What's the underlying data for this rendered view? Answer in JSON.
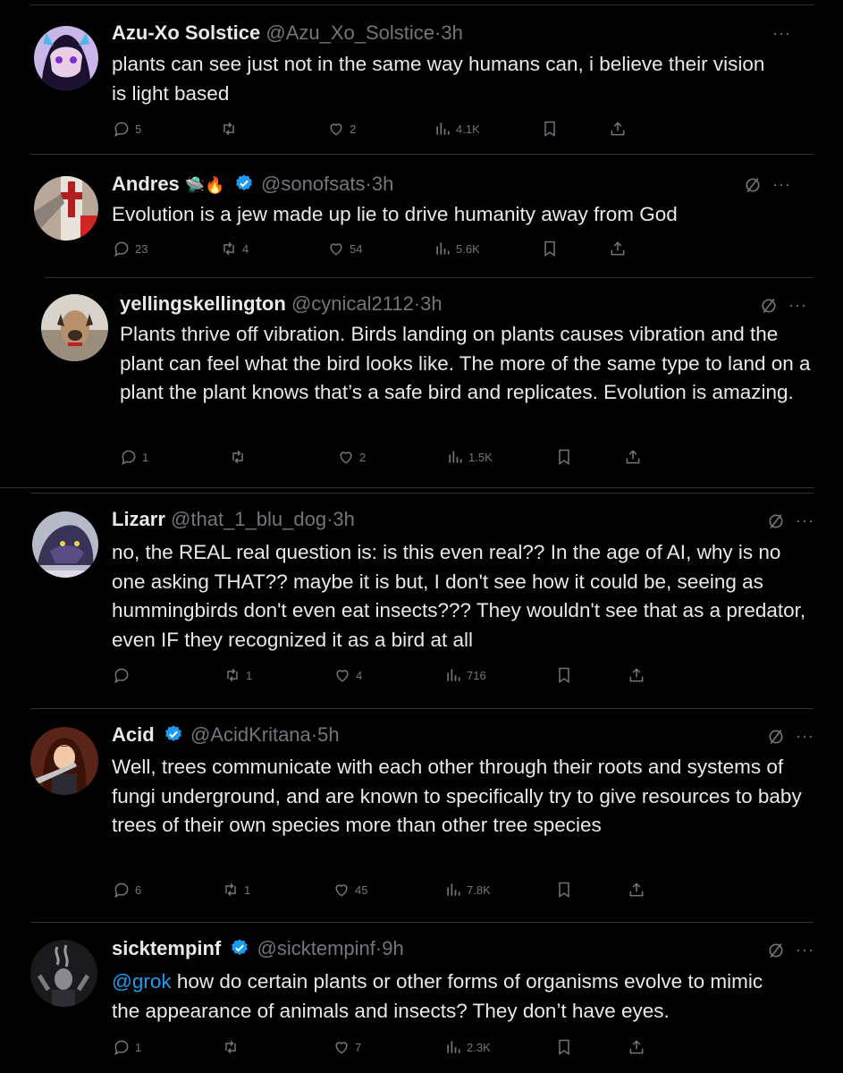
{
  "tweets": [
    {
      "name": "Azu-Xo Solstice",
      "emoji": "",
      "verified": false,
      "handle": "@Azu_Xo_Solstice",
      "time": "3h",
      "text": "plants can see just not in the same way humans can, i believe their vision is light based",
      "replies": "5",
      "retweets": "",
      "likes": "2",
      "views": "4.1K",
      "grok": false
    },
    {
      "name": "Andres",
      "emoji": "🛸🔥",
      "verified": true,
      "handle": "@sonofsats",
      "time": "3h",
      "text": "Evolution is a jew made up lie to drive humanity away from God",
      "replies": "23",
      "retweets": "4",
      "likes": "54",
      "views": "5.6K",
      "grok": true
    },
    {
      "name": "yellingskellington",
      "emoji": "",
      "verified": false,
      "handle": "@cynical2112",
      "time": "3h",
      "text": "Plants thrive off vibration. Birds landing on plants causes vibration and the plant can feel what the bird looks like. The more of the same type to land on a plant the plant knows that’s a safe bird and replicates. Evolution is amazing.",
      "replies": "1",
      "retweets": "",
      "likes": "2",
      "views": "1.5K",
      "grok": true
    },
    {
      "name": "Lizarr",
      "emoji": "",
      "verified": false,
      "handle": "@that_1_blu_dog",
      "time": "3h",
      "text": "no, the REAL real question is: is this even real?? In the age of AI, why is no one asking THAT?? maybe it is but, I don't see how it could be, seeing as hummingbirds don't even eat insects??? They wouldn't see that as a predator, even IF they recognized it as a bird at all",
      "replies": "",
      "retweets": "1",
      "likes": "4",
      "views": "716",
      "grok": true
    },
    {
      "name": "Acid",
      "emoji": "",
      "verified": true,
      "handle": "@AcidKritana",
      "time": "5h",
      "text": "Well, trees communicate with each other through their roots and systems of fungi underground, and are known to specifically try to give resources to baby trees of their own species more than other tree species",
      "replies": "6",
      "retweets": "1",
      "likes": "45",
      "views": "7.8K",
      "grok": true
    },
    {
      "name": "sicktempinf",
      "emoji": "",
      "verified": true,
      "handle": "@sicktempinf",
      "time": "9h",
      "mention": "@grok",
      "text": " how do certain plants or other forms of organisms evolve to mimic the appearance of animals and insects? They don’t have eyes.",
      "replies": "1",
      "retweets": "",
      "likes": "7",
      "views": "2.3K",
      "grok": true
    }
  ],
  "separator": "·",
  "more_label": "···",
  "colors": {
    "background": "#000000",
    "text": "#e7e9ea",
    "muted": "#71767b",
    "link": "#1d9bf0",
    "verified": "#1d9bf0",
    "divider": "#2f3336"
  }
}
